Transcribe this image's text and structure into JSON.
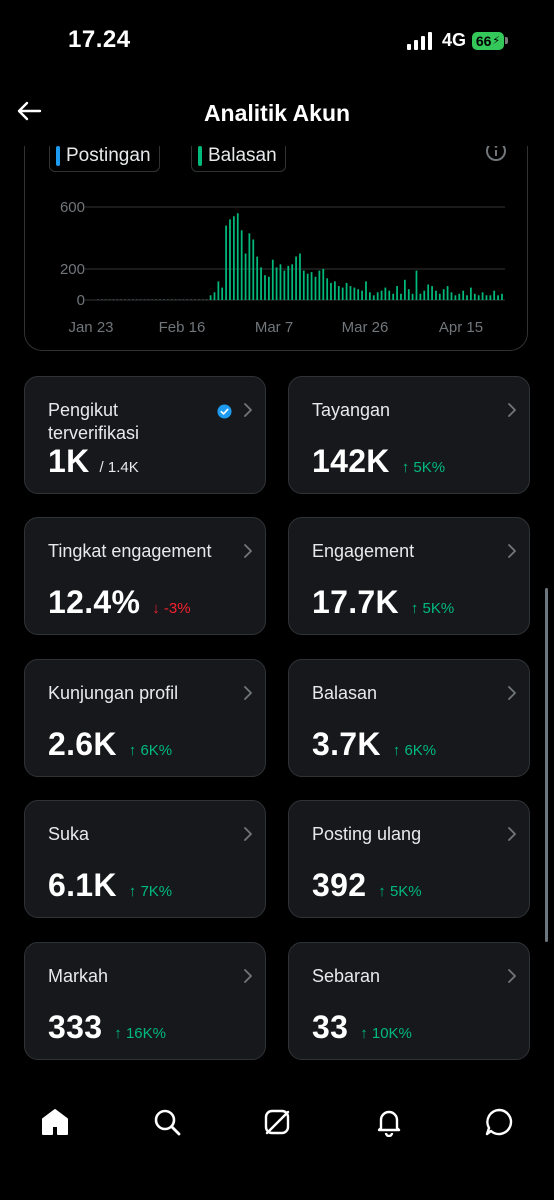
{
  "status_bar": {
    "time": "17.24",
    "network": "4G",
    "battery": "66"
  },
  "header": {
    "title": "Analitik Akun",
    "back_icon": "arrow-left-icon"
  },
  "chart_data": {
    "type": "bar",
    "title": "",
    "xlabel": "",
    "ylabel": "",
    "y_ticks": [
      "600",
      "200",
      "0"
    ],
    "x_ticks": [
      "Jan 23",
      "Feb 16",
      "Mar 7",
      "Mar 26",
      "Apr 15"
    ],
    "ylim": [
      0,
      650
    ],
    "grid": true,
    "legend_position": "top-left",
    "colors": {
      "postingan": "#1d9bf0",
      "balasan": "#00ba7c"
    },
    "series": [
      {
        "name": "Postingan",
        "values": [
          0,
          0,
          0,
          0,
          0,
          0,
          0,
          0,
          0,
          0,
          0,
          0,
          0,
          0,
          0,
          0,
          0,
          0,
          0,
          0,
          0,
          0,
          0,
          0,
          0,
          0,
          0,
          0,
          0,
          0,
          0,
          0,
          0,
          0,
          0,
          0,
          0,
          0,
          0,
          0,
          0,
          0,
          0,
          0,
          0,
          0,
          0,
          0,
          0,
          0,
          0,
          0,
          0,
          0,
          0,
          0,
          0,
          0,
          0,
          0,
          0,
          0,
          0,
          0,
          0,
          0,
          0,
          0,
          0,
          0,
          0,
          0,
          0,
          0,
          0,
          0,
          0,
          0,
          0,
          0,
          0,
          0,
          0,
          0,
          0,
          0,
          0,
          0,
          0
        ]
      },
      {
        "name": "Balasan",
        "values": [
          0,
          0,
          0,
          0,
          0,
          0,
          0,
          0,
          0,
          0,
          0,
          0,
          0,
          0,
          0,
          0,
          0,
          0,
          0,
          0,
          0,
          0,
          0,
          0,
          0,
          0,
          0,
          0,
          0,
          30,
          50,
          120,
          80,
          480,
          520,
          540,
          560,
          450,
          300,
          430,
          390,
          280,
          210,
          160,
          150,
          260,
          210,
          230,
          190,
          220,
          230,
          280,
          300,
          190,
          170,
          180,
          150,
          190,
          200,
          140,
          110,
          120,
          90,
          80,
          110,
          90,
          80,
          70,
          60,
          120,
          50,
          30,
          50,
          60,
          80,
          60,
          40,
          90,
          40,
          130,
          70,
          40,
          190,
          40,
          60,
          100,
          90,
          60,
          40,
          70,
          90,
          50,
          30,
          40,
          60,
          30,
          80,
          40,
          30,
          50,
          30,
          30,
          60,
          30,
          40
        ]
      }
    ],
    "x": {
      "start": "2024-01-23",
      "end": "2024-04-22",
      "count": 90
    }
  },
  "cards": [
    {
      "id": "pengikut-terverifikasi",
      "label": "Pengikut terverifikasi",
      "value": "1K",
      "sub": "/ 1.4K",
      "change": "",
      "direction": "",
      "verified": true
    },
    {
      "id": "tayangan",
      "label": "Tayangan",
      "value": "142K",
      "sub": "",
      "change": "↑ 5K%",
      "direction": "up"
    },
    {
      "id": "tingkat-engagement",
      "label": "Tingkat engagement",
      "value": "12.4%",
      "sub": "",
      "change": "↓ -3%",
      "direction": "down"
    },
    {
      "id": "engagement",
      "label": "Engagement",
      "value": "17.7K",
      "sub": "",
      "change": "↑ 5K%",
      "direction": "up"
    },
    {
      "id": "kunjungan-profil",
      "label": "Kunjungan profil",
      "value": "2.6K",
      "sub": "",
      "change": "↑ 6K%",
      "direction": "up"
    },
    {
      "id": "balasan",
      "label": "Balasan",
      "value": "3.7K",
      "sub": "",
      "change": "↑ 6K%",
      "direction": "up"
    },
    {
      "id": "suka",
      "label": "Suka",
      "value": "6.1K",
      "sub": "",
      "change": "↑ 7K%",
      "direction": "up"
    },
    {
      "id": "posting-ulang",
      "label": "Posting ulang",
      "value": "392",
      "sub": "",
      "change": "↑ 5K%",
      "direction": "up"
    },
    {
      "id": "markah",
      "label": "Markah",
      "value": "333",
      "sub": "",
      "change": "↑ 16K%",
      "direction": "up"
    },
    {
      "id": "sebaran",
      "label": "Sebaran",
      "value": "33",
      "sub": "",
      "change": "↑ 10K%",
      "direction": "up"
    }
  ],
  "tabbar": {
    "icons": [
      "home-icon",
      "search-icon",
      "grok-icon",
      "notifications-icon",
      "messages-icon"
    ]
  }
}
